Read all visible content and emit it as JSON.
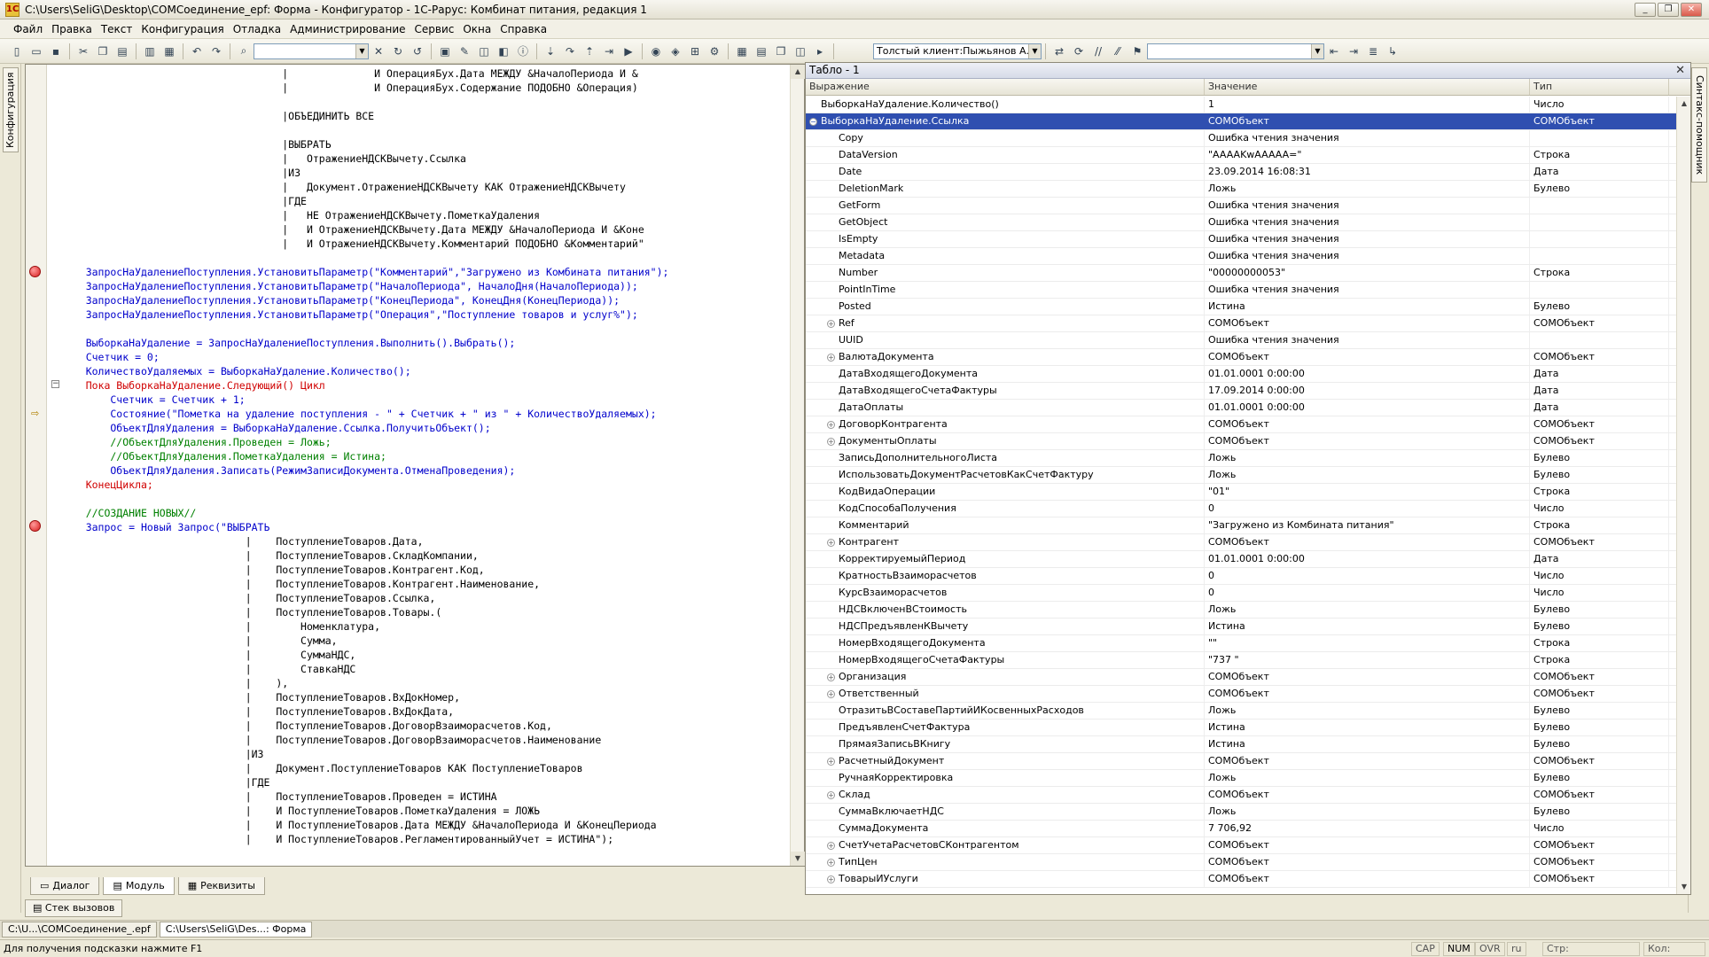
{
  "window": {
    "title": "C:\\Users\\SeliG\\Desktop\\COMСоединение_epf: Форма - Конфигуратор - 1С-Рарус: Комбинат питания, редакция 1",
    "app_icon": "1c-app-icon",
    "buttons": [
      "_",
      "❐",
      "✕"
    ]
  },
  "menu": [
    "Файл",
    "Правка",
    "Текст",
    "Конфигурация",
    "Отладка",
    "Администрирование",
    "Сервис",
    "Окна",
    "Справка"
  ],
  "toolbar": {
    "search_value": "",
    "client_combo": "Толстый клиент:Пыжьянов А.В. (Ст",
    "right_combo": ""
  },
  "left_strip": {
    "tab": "Конфигурация"
  },
  "right_strip": {
    "tab": "Синтакс-помощник"
  },
  "code": {
    "lines": [
      "                                    |              И ОперацияБух.Дата МЕЖДУ &НачалоПериода И &",
      "                                    |              И ОперацияБух.Содержание ПОДОБНО &Операция)",
      "",
      "                                    |ОБЪЕДИНИТЬ ВСЕ",
      "",
      "                                    |ВЫБРАТЬ",
      "                                    |   ОтражениеНДСКВычету.Ссылка",
      "                                    |ИЗ",
      "                                    |   Документ.ОтражениеНДСКВычету КАК ОтражениеНДСКВычету",
      "                                    |ГДЕ",
      "                                    |   НЕ ОтражениеНДСКВычету.ПометкаУдаления",
      "                                    |   И ОтражениеНДСКВычету.Дата МЕЖДУ &НачалоПериода И &Коне",
      "                                    |   И ОтражениеНДСКВычету.Комментарий ПОДОБНО &Комментарий\"",
      "",
      "    ЗапросНаУдалениеПоступления.УстановитьПараметр(\"Комментарий\",\"Загружено из Комбината питания\");",
      "    ЗапросНаУдалениеПоступления.УстановитьПараметр(\"НачалоПериода\", НачалоДня(НачалоПериода));",
      "    ЗапросНаУдалениеПоступления.УстановитьПараметр(\"КонецПериода\", КонецДня(КонецПериода));",
      "    ЗапросНаУдалениеПоступления.УстановитьПараметр(\"Операция\",\"Поступление товаров и услуг%\");",
      "",
      "    ВыборкаНаУдаление = ЗапросНаУдалениеПоступления.Выполнить().Выбрать();",
      "    Счетчик = 0;",
      "    КоличествоУдаляемых = ВыборкаНаУдаление.Количество();",
      "    Пока ВыборкаНаУдаление.Следующий() Цикл",
      "        Счетчик = Счетчик + 1;",
      "        Состояние(\"Пометка на удаление поступления - \" + Счетчик + \" из \" + КоличествоУдаляемых);",
      "        ОбъектДляУдаления = ВыборкаНаУдаление.Ссылка.ПолучитьОбъект();",
      "        //ОбъектДляУдаления.Проведен = Ложь;",
      "        //ОбъектДляУдаления.ПометкаУдаления = Истина;",
      "        ОбъектДляУдаления.Записать(РежимЗаписиДокумента.ОтменаПроведения);",
      "    КонецЦикла;",
      "",
      "    //СОЗДАНИЕ НОВЫХ//",
      "    Запрос = Новый Запрос(\"ВЫБРАТЬ",
      "                              |    ПоступлениеТоваров.Дата,",
      "                              |    ПоступлениеТоваров.СкладКомпании,",
      "                              |    ПоступлениеТоваров.Контрагент.Код,",
      "                              |    ПоступлениеТоваров.Контрагент.Наименование,",
      "                              |    ПоступлениеТоваров.Ссылка,",
      "                              |    ПоступлениеТоваров.Товары.(",
      "                              |        Номенклатура,",
      "                              |        Сумма,",
      "                              |        СуммаНДС,",
      "                              |        СтавкаНДС",
      "                              |    ),",
      "                              |    ПоступлениеТоваров.ВхДокНомер,",
      "                              |    ПоступлениеТоваров.ВхДокДата,",
      "                              |    ПоступлениеТоваров.ДоговорВзаиморасчетов.Код,",
      "                              |    ПоступлениеТоваров.ДоговорВзаиморасчетов.Наименование",
      "                              |ИЗ",
      "                              |    Документ.ПоступлениеТоваров КАК ПоступлениеТоваров",
      "                              |ГДЕ",
      "                              |    ПоступлениеТоваров.Проведен = ИСТИНА",
      "                              |    И ПоступлениеТоваров.ПометкаУдаления = ЛОЖЬ",
      "                              |    И ПоступлениеТоваров.Дата МЕЖДУ &НачалоПериода И &КонецПериода",
      "                              |    И ПоступлениеТоваров.РегламентированныйУчет = ИСТИНА\");"
    ]
  },
  "editor_tabs": [
    "Диалог",
    "Модуль",
    "Реквизиты"
  ],
  "stack_button": "Стек вызовов",
  "taskbar": [
    "C:\\U...\\COMСоединение_.epf",
    "C:\\Users\\SeliG\\Des...: Форма"
  ],
  "status": {
    "hint": "Для получения подсказки нажмите F1",
    "indicators": [
      "CAP",
      "NUM",
      "OVR",
      "ru",
      "Стр:",
      "Кол:"
    ]
  },
  "table": {
    "title": "Табло - 1",
    "columns": [
      "Выражение",
      "Значение",
      "Тип"
    ],
    "rows": [
      {
        "name": "ВыборкаНаУдаление.Количество()",
        "value": "1",
        "type": "Число",
        "level": 0,
        "exp": ""
      },
      {
        "name": "ВыборкаНаУдаление.Ссылка",
        "value": "COMОбъект",
        "type": "COMОбъект",
        "level": 0,
        "exp": "−",
        "sel": true
      },
      {
        "name": "Copy",
        "value": "Ошибка чтения значения",
        "type": "",
        "level": 1,
        "exp": ""
      },
      {
        "name": "DataVersion",
        "value": "\"AAAAKwAAAAA=\"",
        "type": "Строка",
        "level": 1,
        "exp": ""
      },
      {
        "name": "Date",
        "value": "23.09.2014 16:08:31",
        "type": "Дата",
        "level": 1,
        "exp": ""
      },
      {
        "name": "DeletionMark",
        "value": "Ложь",
        "type": "Булево",
        "level": 1,
        "exp": ""
      },
      {
        "name": "GetForm",
        "value": "Ошибка чтения значения",
        "type": "",
        "level": 1,
        "exp": ""
      },
      {
        "name": "GetObject",
        "value": "Ошибка чтения значения",
        "type": "",
        "level": 1,
        "exp": ""
      },
      {
        "name": "IsEmpty",
        "value": "Ошибка чтения значения",
        "type": "",
        "level": 1,
        "exp": ""
      },
      {
        "name": "Metadata",
        "value": "Ошибка чтения значения",
        "type": "",
        "level": 1,
        "exp": ""
      },
      {
        "name": "Number",
        "value": "\"00000000053\"",
        "type": "Строка",
        "level": 1,
        "exp": ""
      },
      {
        "name": "PointInTime",
        "value": "Ошибка чтения значения",
        "type": "",
        "level": 1,
        "exp": ""
      },
      {
        "name": "Posted",
        "value": "Истина",
        "type": "Булево",
        "level": 1,
        "exp": ""
      },
      {
        "name": "Ref",
        "value": "COMОбъект",
        "type": "COMОбъект",
        "level": 1,
        "exp": "+"
      },
      {
        "name": "UUID",
        "value": "Ошибка чтения значения",
        "type": "",
        "level": 1,
        "exp": ""
      },
      {
        "name": "ВалютаДокумента",
        "value": "COMОбъект",
        "type": "COMОбъект",
        "level": 1,
        "exp": "+"
      },
      {
        "name": "ДатаВходящегоДокумента",
        "value": "01.01.0001 0:00:00",
        "type": "Дата",
        "level": 1,
        "exp": ""
      },
      {
        "name": "ДатаВходящегоСчетаФактуры",
        "value": "17.09.2014 0:00:00",
        "type": "Дата",
        "level": 1,
        "exp": ""
      },
      {
        "name": "ДатаОплаты",
        "value": "01.01.0001 0:00:00",
        "type": "Дата",
        "level": 1,
        "exp": ""
      },
      {
        "name": "ДоговорКонтрагента",
        "value": "COMОбъект",
        "type": "COMОбъект",
        "level": 1,
        "exp": "+"
      },
      {
        "name": "ДокументыОплаты",
        "value": "COMОбъект",
        "type": "COMОбъект",
        "level": 1,
        "exp": "+"
      },
      {
        "name": "ЗаписьДополнительногоЛиста",
        "value": "Ложь",
        "type": "Булево",
        "level": 1,
        "exp": ""
      },
      {
        "name": "ИспользоватьДокументРасчетовКакСчетФактуру",
        "value": "Ложь",
        "type": "Булево",
        "level": 1,
        "exp": ""
      },
      {
        "name": "КодВидаОперации",
        "value": "\"01\"",
        "type": "Строка",
        "level": 1,
        "exp": ""
      },
      {
        "name": "КодСпособаПолучения",
        "value": "0",
        "type": "Число",
        "level": 1,
        "exp": ""
      },
      {
        "name": "Комментарий",
        "value": "\"Загружено из Комбината питания\"",
        "type": "Строка",
        "level": 1,
        "exp": ""
      },
      {
        "name": "Контрагент",
        "value": "COMОбъект",
        "type": "COMОбъект",
        "level": 1,
        "exp": "+"
      },
      {
        "name": "КорректируемыйПериод",
        "value": "01.01.0001 0:00:00",
        "type": "Дата",
        "level": 1,
        "exp": ""
      },
      {
        "name": "КратностьВзаиморасчетов",
        "value": "0",
        "type": "Число",
        "level": 1,
        "exp": ""
      },
      {
        "name": "КурсВзаиморасчетов",
        "value": "0",
        "type": "Число",
        "level": 1,
        "exp": ""
      },
      {
        "name": "НДСВключенВСтоимость",
        "value": "Ложь",
        "type": "Булево",
        "level": 1,
        "exp": ""
      },
      {
        "name": "НДСПредъявленКВычету",
        "value": "Истина",
        "type": "Булево",
        "level": 1,
        "exp": ""
      },
      {
        "name": "НомерВходящегоДокумента",
        "value": "\"\"",
        "type": "Строка",
        "level": 1,
        "exp": ""
      },
      {
        "name": "НомерВходящегоСчетаФактуры",
        "value": "\"737                    \"",
        "type": "Строка",
        "level": 1,
        "exp": ""
      },
      {
        "name": "Организация",
        "value": "COMОбъект",
        "type": "COMОбъект",
        "level": 1,
        "exp": "+"
      },
      {
        "name": "Ответственный",
        "value": "COMОбъект",
        "type": "COMОбъект",
        "level": 1,
        "exp": "+"
      },
      {
        "name": "ОтразитьВСоставеПартийИКосвенныхРасходов",
        "value": "Ложь",
        "type": "Булево",
        "level": 1,
        "exp": ""
      },
      {
        "name": "ПредъявленСчетФактура",
        "value": "Истина",
        "type": "Булево",
        "level": 1,
        "exp": ""
      },
      {
        "name": "ПрямаяЗаписьВКнигу",
        "value": "Истина",
        "type": "Булево",
        "level": 1,
        "exp": ""
      },
      {
        "name": "РасчетныйДокумент",
        "value": "COMОбъект",
        "type": "COMОбъект",
        "level": 1,
        "exp": "+"
      },
      {
        "name": "РучнаяКорректировка",
        "value": "Ложь",
        "type": "Булево",
        "level": 1,
        "exp": ""
      },
      {
        "name": "Склад",
        "value": "COMОбъект",
        "type": "COMОбъект",
        "level": 1,
        "exp": "+"
      },
      {
        "name": "СуммаВключаетНДС",
        "value": "Ложь",
        "type": "Булево",
        "level": 1,
        "exp": ""
      },
      {
        "name": "СуммаДокумента",
        "value": "7 706,92",
        "type": "Число",
        "level": 1,
        "exp": ""
      },
      {
        "name": "СчетУчетаРасчетовСКонтрагентом",
        "value": "COMОбъект",
        "type": "COMОбъект",
        "level": 1,
        "exp": "+"
      },
      {
        "name": "ТипЦен",
        "value": "COMОбъект",
        "type": "COMОбъект",
        "level": 1,
        "exp": "+"
      },
      {
        "name": "ТоварыИУслуги",
        "value": "COMОбъект",
        "type": "COMОбъект",
        "level": 1,
        "exp": "+"
      }
    ]
  }
}
